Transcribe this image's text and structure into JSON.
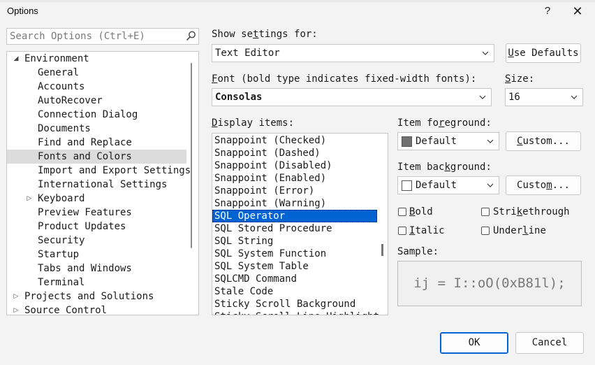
{
  "window": {
    "title": "Options",
    "help": "?",
    "close": "✕"
  },
  "search": {
    "placeholder": "Search Options (Ctrl+E)"
  },
  "tree": [
    {
      "label": "Environment",
      "indent": 0,
      "expander": "expanded"
    },
    {
      "label": "General",
      "indent": 1
    },
    {
      "label": "Accounts",
      "indent": 1
    },
    {
      "label": "AutoRecover",
      "indent": 1
    },
    {
      "label": "Connection Dialog",
      "indent": 1
    },
    {
      "label": "Documents",
      "indent": 1
    },
    {
      "label": "Find and Replace",
      "indent": 1
    },
    {
      "label": "Fonts and Colors",
      "indent": 1,
      "selected": true
    },
    {
      "label": "Import and Export Settings",
      "indent": 1
    },
    {
      "label": "International Settings",
      "indent": 1
    },
    {
      "label": "Keyboard",
      "indent": 1,
      "expander": "collapsed"
    },
    {
      "label": "Preview Features",
      "indent": 1
    },
    {
      "label": "Product Updates",
      "indent": 1
    },
    {
      "label": "Security",
      "indent": 1
    },
    {
      "label": "Startup",
      "indent": 1
    },
    {
      "label": "Tabs and Windows",
      "indent": 1
    },
    {
      "label": "Terminal",
      "indent": 1
    },
    {
      "label": "Projects and Solutions",
      "indent": 0,
      "expander": "collapsed"
    },
    {
      "label": "Source Control",
      "indent": 0,
      "expander": "collapsed"
    }
  ],
  "show_settings": {
    "label_pre": "Show se",
    "label_key": "t",
    "label_post": "tings for:",
    "value": "Text Editor"
  },
  "use_defaults": {
    "key": "U",
    "rest": "se Defaults"
  },
  "font": {
    "label_key": "F",
    "label_rest": "ont (bold type indicates fixed-width fonts):",
    "value": "Consolas"
  },
  "size": {
    "label_key": "S",
    "label_rest": "ize:",
    "value": "16"
  },
  "display_items": {
    "label_key": "D",
    "label_rest": "isplay items:",
    "items": [
      "Snappoint (Checked)",
      "Snappoint (Dashed)",
      "Snappoint (Disabled)",
      "Snappoint (Enabled)",
      "Snappoint (Error)",
      "Snappoint (Warning)",
      "SQL Operator",
      "SQL Stored Procedure",
      "SQL String",
      "SQL System Function",
      "SQL System Table",
      "SQLCMD Command",
      "Stale Code",
      "Sticky Scroll Background",
      "Sticky Scroll Line Highlight"
    ],
    "selected_index": 6
  },
  "item_foreground": {
    "label_pre": "Item fo",
    "label_key": "r",
    "label_post": "eground:",
    "value": "Default",
    "swatch_color": "#707070"
  },
  "custom_fg": {
    "pre": "",
    "key": "C",
    "post": "ustom..."
  },
  "item_background": {
    "label_pre": "Item bac",
    "label_key": "k",
    "label_post": "ground:",
    "value": "Default",
    "swatch_color": "#ffffff"
  },
  "custom_bg": {
    "pre": "Custo",
    "key": "m",
    "post": "..."
  },
  "checks": {
    "bold": {
      "key": "B",
      "rest": "old",
      "checked": false
    },
    "italic": {
      "key": "I",
      "rest": "talic",
      "checked": false
    },
    "strike": {
      "pre": "Stri",
      "key": "k",
      "post": "ethrough",
      "checked": false
    },
    "underline": {
      "pre": "Under",
      "key": "l",
      "post": "ine",
      "checked": false
    }
  },
  "sample": {
    "label": "Sample:",
    "text": "ij = I::oO(0xB81l);"
  },
  "ok": "OK",
  "cancel": "Cancel",
  "colors": {
    "accent": "#0063d1",
    "selection_tree": "#dcdcdc"
  }
}
